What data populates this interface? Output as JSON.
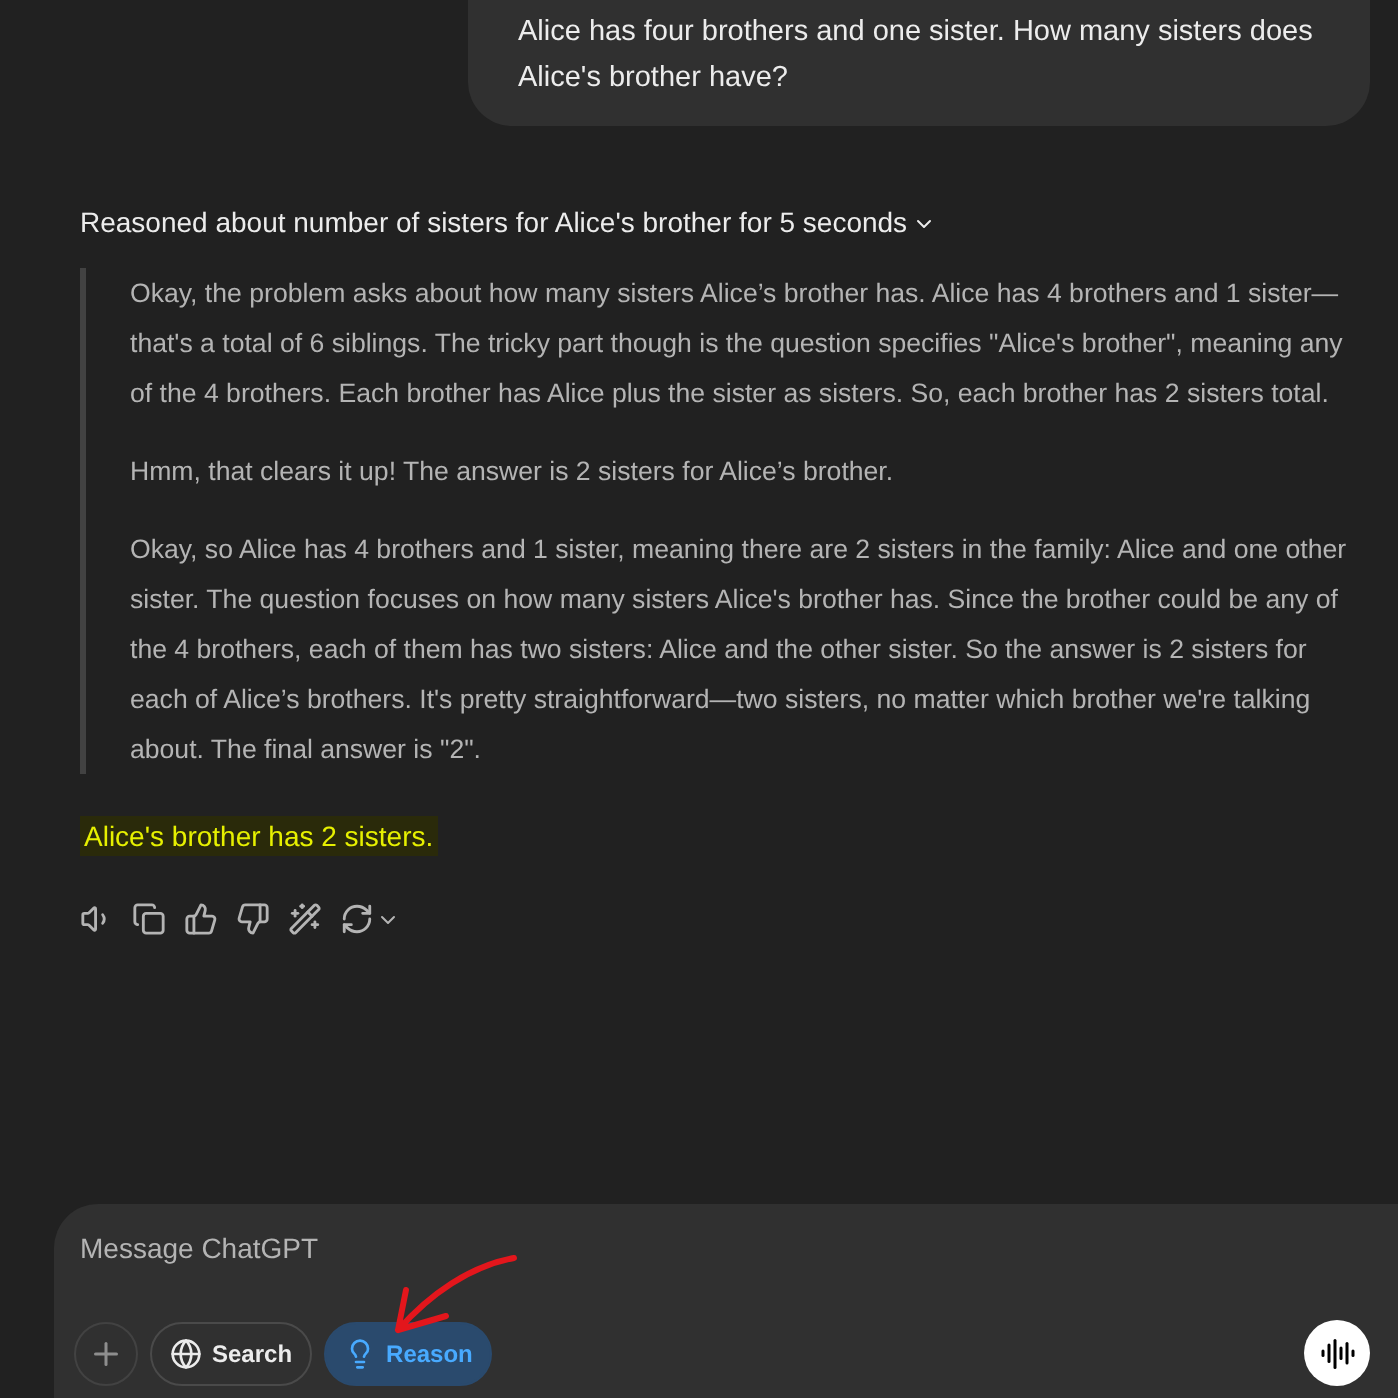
{
  "user_message": "Alice has four brothers and one sister. How many sisters does Alice's brother have?",
  "reasoning": {
    "summary": "Reasoned about number of sisters for Alice's brother for 5 seconds",
    "expanded": true,
    "paragraphs": [
      "Okay, the problem asks about how many sisters Alice’s brother has. Alice has 4 brothers and 1 sister—that's a total of 6 siblings. The tricky part though is the question specifies \"Alice's brother\", meaning any of the 4 brothers. Each brother has Alice plus the sister as sisters. So, each brother has 2 sisters total.",
      "Hmm, that clears it up! The answer is 2 sisters for Alice’s brother.",
      "Okay, so Alice has 4 brothers and 1 sister, meaning there are 2 sisters in the family: Alice and one other sister. The question focuses on how many sisters Alice's brother has. Since the brother could be any of the 4 brothers, each of them has two sisters: Alice and the other sister. So the answer is 2 sisters for each of Alice’s brothers. It's pretty straightforward—two sisters, no matter which brother we're talking about. The final answer is \"2\"."
    ]
  },
  "answer": {
    "text": "Alice's brother has 2 sisters.",
    "highlighted": true
  },
  "composer": {
    "placeholder": "Message ChatGPT",
    "tools": [
      {
        "kind": "search",
        "label": "Search",
        "selected": false
      },
      {
        "kind": "reason",
        "label": "Reason",
        "selected": true
      }
    ]
  }
}
